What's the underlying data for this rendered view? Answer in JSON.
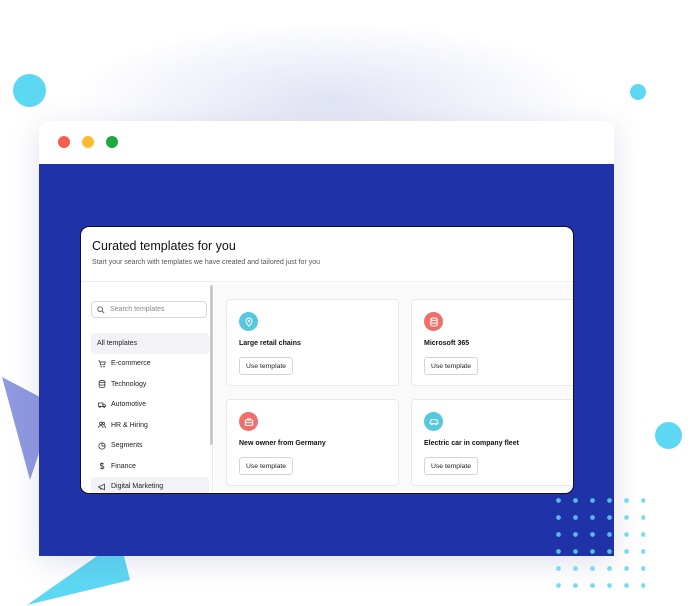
{
  "window": {
    "traffic_lights": [
      "#f25f4c",
      "#fbbd2e",
      "#1eaa3a"
    ]
  },
  "colors": {
    "viewport_bg": "#1f32a8",
    "accent_cyan": "#5dd8f3"
  },
  "app": {
    "title": "Curated templates for you",
    "subtitle": "Start your search with templates we have created and tailored just for you",
    "search": {
      "placeholder": "Search templates",
      "icon": "search-icon"
    },
    "nav": [
      {
        "label": "All templates",
        "icon": ""
      },
      {
        "label": "E-commerce",
        "icon": "cart-icon"
      },
      {
        "label": "Technology",
        "icon": "database-icon"
      },
      {
        "label": "Automotive",
        "icon": "truck-icon"
      },
      {
        "label": "HR & Hiring",
        "icon": "people-icon"
      },
      {
        "label": "Segments",
        "icon": "pie-chart-icon"
      },
      {
        "label": "Finance",
        "icon": "dollar-icon"
      },
      {
        "label": "Digital Marketing",
        "icon": "megaphone-icon"
      }
    ],
    "templates": [
      {
        "name": "Large retail chains",
        "button": "Use template",
        "icon": "location-pin-icon",
        "color": "#56c7dc"
      },
      {
        "name": "Microsoft 365",
        "button": "Use template",
        "icon": "database-icon",
        "color": "#ef6f6a"
      },
      {
        "name": "New owner from Germany",
        "button": "Use template",
        "icon": "briefcase-icon",
        "color": "#ef6f6a"
      },
      {
        "name": "Electric car in company fleet",
        "button": "Use template",
        "icon": "car-icon",
        "color": "#56c7dc"
      }
    ]
  }
}
